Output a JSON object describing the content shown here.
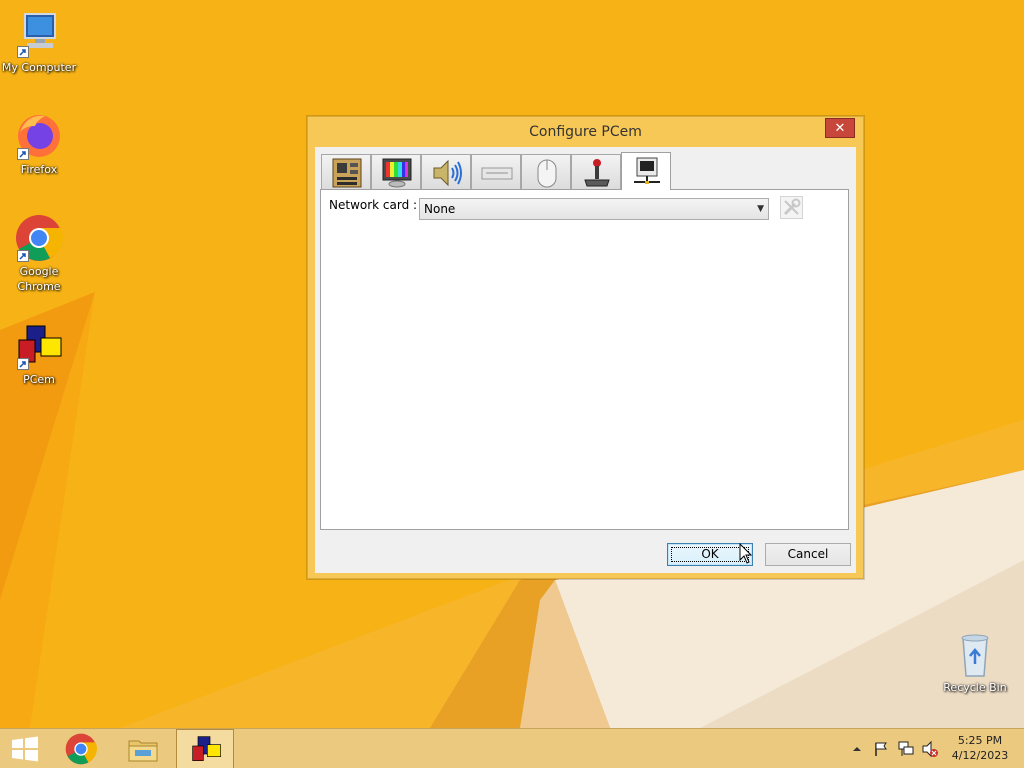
{
  "desktop": {
    "icons": [
      {
        "label": "My Computer",
        "icon": "computer-icon"
      },
      {
        "label": "Firefox",
        "icon": "firefox-icon"
      },
      {
        "label": "Google Chrome",
        "icon": "chrome-icon"
      },
      {
        "label": "PCem",
        "icon": "pcem-icon"
      },
      {
        "label": "Recycle Bin",
        "icon": "recycle-bin-icon"
      }
    ]
  },
  "dialog": {
    "title": "Configure PCem",
    "close_symbol": "✕",
    "tabs": [
      {
        "icon": "motherboard-icon",
        "active": false
      },
      {
        "icon": "display-icon",
        "active": false
      },
      {
        "icon": "speaker-icon",
        "active": false
      },
      {
        "icon": "drive-icon",
        "active": false
      },
      {
        "icon": "mouse-icon",
        "active": false
      },
      {
        "icon": "joystick-icon",
        "active": false
      },
      {
        "icon": "network-icon",
        "active": true
      }
    ],
    "network": {
      "label": "Network card :",
      "selected": "None",
      "dropdown_arrow": "▼"
    },
    "ok_label": "OK",
    "cancel_label": "Cancel"
  },
  "taskbar": {
    "items": [
      {
        "icon": "start-icon"
      },
      {
        "icon": "chrome-icon"
      },
      {
        "icon": "file-explorer-icon"
      },
      {
        "icon": "pcem-icon",
        "active": true
      }
    ],
    "tray_icons": [
      "show-hidden-icon",
      "action-center-flag-icon",
      "network-icon",
      "volume-muted-icon"
    ],
    "clock": {
      "time": "5:25 PM",
      "date": "4/12/2023"
    }
  },
  "colors": {
    "wallpaper": "#f7b316",
    "dialog_frame": "#f8c857",
    "close_button": "#c7483a",
    "taskbar": "#ebc97e"
  }
}
